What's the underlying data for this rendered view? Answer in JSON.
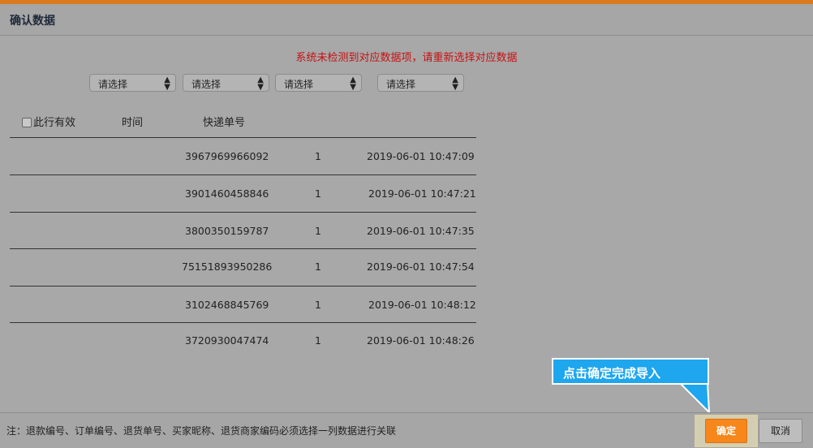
{
  "header": {
    "title": "确认数据"
  },
  "warning": "系统未检测到对应数据项，请重新选择对应数据",
  "selects": [
    "请选择",
    "请选择",
    "请选择",
    "请选择"
  ],
  "columns": {
    "valid": "此行有效",
    "time": "时间",
    "tracking": "快递单号"
  },
  "rows": [
    {
      "tracking": "3967969966092",
      "qty": "1",
      "time": "2019-06-01 10:47:09"
    },
    {
      "tracking": "3901460458846",
      "qty": "1",
      "time": "2019-06-01 10:47:21"
    },
    {
      "tracking": "3800350159787",
      "qty": "1",
      "time": "2019-06-01 10:47:35"
    },
    {
      "tracking": "75151893950286",
      "qty": "1",
      "time": "2019-06-01 10:47:54"
    },
    {
      "tracking": "3102468845769",
      "qty": "1",
      "time": "2019-06-01 10:48:12"
    },
    {
      "tracking": "3720930047474",
      "qty": "1",
      "time": "2019-06-01 10:48:26"
    }
  ],
  "callout": "点击确定完成导入",
  "footer": {
    "note": "注：退款编号、订单编号、退货单号、买家昵称、退货商家编码必须选择一列数据进行关联",
    "ok_label": "确定",
    "cancel_label": "取消"
  },
  "colors": {
    "accent": "#f7861b",
    "callout": "#1ea6ee",
    "warning": "#c81010"
  }
}
